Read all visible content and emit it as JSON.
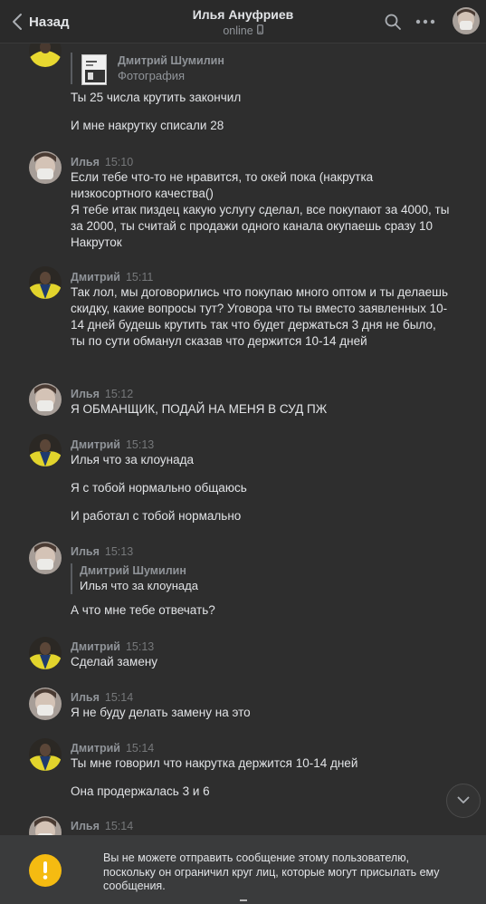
{
  "header": {
    "back_label": "Назад",
    "title": "Илья Ануфриев",
    "status": "online"
  },
  "feed": {
    "m0": {
      "reply_name": "Дмитрий Шумилин",
      "reply_sub": "Фотография",
      "lines": [
        "Ты 25 числа крутить закончил",
        "И мне накрутку списали 28"
      ]
    },
    "m1": {
      "author": "Илья",
      "time": "15:10",
      "text": "Если тебе что-то не нравится, то окей пока (накрутка низкосортного качества()\nЯ тебе итак пиздец какую услугу сделал, все покупают за 4000, ты за 2000, ты считай с продажи одного канала окупаешь сразу 10 Накруток"
    },
    "m2": {
      "author": "Дмитрий",
      "time": "15:11",
      "text": "Так лол, мы договорились что покупаю много оптом и ты делаешь скидку, какие вопросы тут? Уговора что ты вместо заявленных 10-14 дней будешь крутить так что будет держаться 3 дня не было, ты по сути обманул сказав что держится 10-14 дней"
    },
    "m3": {
      "author": "Илья",
      "time": "15:12",
      "text": "Я ОБМАНЩИК, ПОДАЙ НА МЕНЯ В СУД ПЖ"
    },
    "m4": {
      "author": "Дмитрий",
      "time": "15:13",
      "lines": [
        "Илья что за клоунада",
        "Я с тобой нормально общаюсь",
        "И работал с тобой нормально"
      ]
    },
    "m5": {
      "author": "Илья",
      "time": "15:13",
      "reply_name": "Дмитрий Шумилин",
      "reply_text": "Илья что за клоунада",
      "text": "А что мне тебе отвечать?"
    },
    "m6": {
      "author": "Дмитрий",
      "time": "15:13",
      "text": "Сделай замену"
    },
    "m7": {
      "author": "Илья",
      "time": "15:14",
      "text": "Я не буду делать замену на это"
    },
    "m8": {
      "author": "Дмитрий",
      "time": "15:14",
      "lines": [
        "Ты мне говорил что накрутка держится 10-14 дней",
        "Она продержалась 3 и 6"
      ]
    },
    "m9": {
      "author": "Илья",
      "time": "15:14"
    }
  },
  "notice": {
    "text": "Вы не можете отправить сообщение этому пользователю, поскольку он ограничил круг лиц, которые могут присылать ему сообщения."
  },
  "colors": {
    "background": "#2e2e2e",
    "header": "#2a2a2a",
    "text": "#e1e3e6",
    "muted": "#909499",
    "notice_bg": "#3a3b3c",
    "warning": "#f5bb11"
  },
  "icons": {
    "back": "chevron-left-icon",
    "search": "search-icon",
    "more": "more-horizontal-icon",
    "phone": "mobile-phone-icon",
    "scroll": "chevron-down-icon",
    "warning": "exclamation-icon"
  }
}
